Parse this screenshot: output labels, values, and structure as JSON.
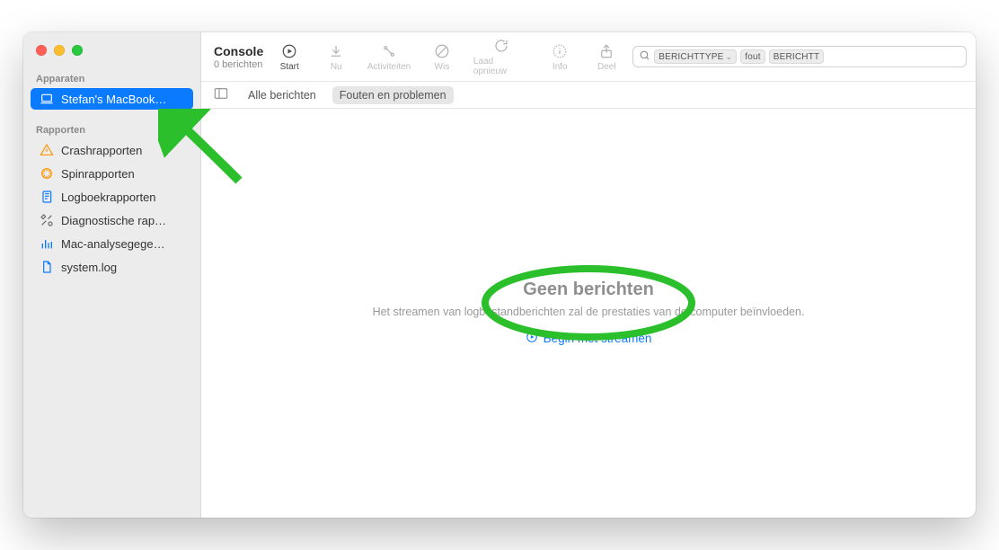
{
  "window": {
    "title": "Console",
    "subtitle": "0 berichten"
  },
  "toolbar": {
    "start": "Start",
    "now": "Nu",
    "activities": "Activiteiten",
    "clear": "Wis",
    "reload": "Laad opnieuw",
    "info": "Info",
    "share": "Deel"
  },
  "search": {
    "token_kind": "BERICHTTYPE",
    "token_value": "fout",
    "trailing_token": "BERICHTT",
    "placeholder": ""
  },
  "filter": {
    "all": "Alle berichten",
    "errors": "Fouten en problemen"
  },
  "sidebar": {
    "devices_label": "Apparaten",
    "devices": [
      {
        "label": "Stefan's MacBook…"
      }
    ],
    "reports_label": "Rapporten",
    "reports": [
      {
        "label": "Crashrapporten"
      },
      {
        "label": "Spinrapporten"
      },
      {
        "label": "Logboekrapporten"
      },
      {
        "label": "Diagnostische rap…"
      },
      {
        "label": "Mac-analysegege…"
      },
      {
        "label": "system.log"
      }
    ]
  },
  "empty": {
    "title": "Geen berichten",
    "message": "Het streamen van logbestandberichten zal de prestaties van de computer beïnvloeden.",
    "action": "Begin met streamen"
  }
}
